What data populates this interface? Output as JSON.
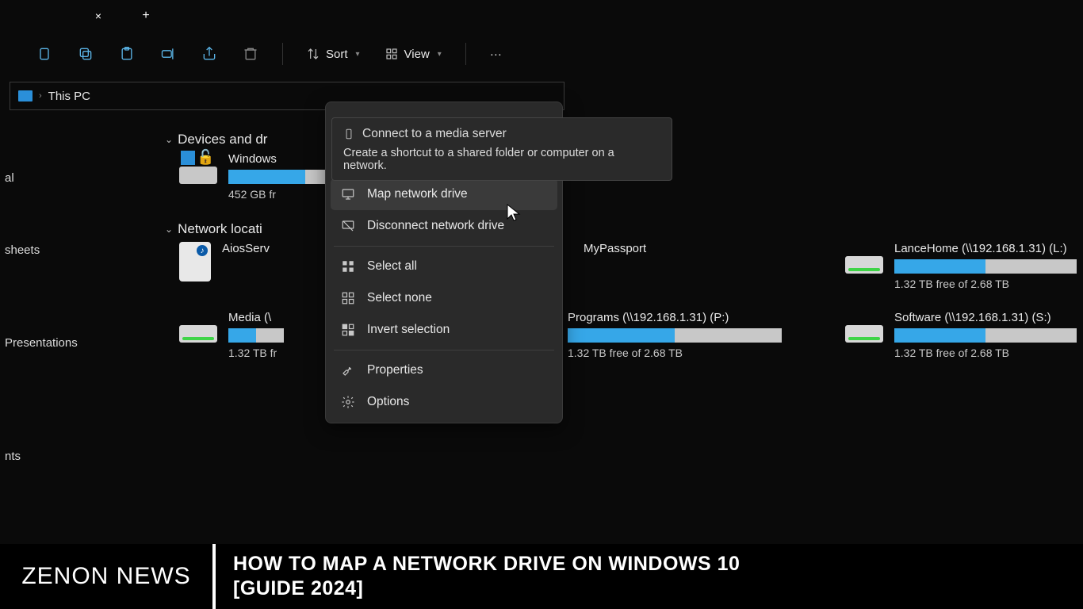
{
  "tabs": {
    "close": "×",
    "new": "+"
  },
  "toolbar": {
    "sort": "Sort",
    "view": "View"
  },
  "breadcrumb": {
    "sep": "›",
    "location": "This PC"
  },
  "sidebar": {
    "items": [
      "al",
      "sheets",
      "Presentations",
      "nts"
    ]
  },
  "sections": {
    "devices": "Devices and dr",
    "network": "Network locati"
  },
  "drives": {
    "local": {
      "name": "Windows",
      "free": "452 GB fr",
      "fill": 42
    },
    "aios": {
      "name": "AiosServ"
    },
    "mypassport": {
      "name": "MyPassport"
    },
    "lancehome": {
      "name": "LanceHome (\\\\192.168.1.31) (L:)",
      "free": "1.32 TB free of 2.68 TB",
      "fill": 50
    },
    "media": {
      "name": "Media (\\",
      "free": "1.32 TB fr",
      "fill": 50
    },
    "programs": {
      "name": "Programs (\\\\192.168.1.31) (P:)",
      "free": "1.32 TB free of 2.68 TB",
      "fill": 50
    },
    "software": {
      "name": "Software (\\\\192.168.1.31) (S:)",
      "free": "1.32 TB free of 2.68 TB",
      "fill": 50
    }
  },
  "tooltip": {
    "title": "Connect to a media server",
    "body": "Create a shortcut to a shared folder or computer on a network."
  },
  "menu": {
    "map": "Map network drive",
    "disconnect": "Disconnect network drive",
    "selectall": "Select all",
    "selectnone": "Select none",
    "invert": "Invert selection",
    "properties": "Properties",
    "options": "Options"
  },
  "footer": {
    "brand": "ZENON NEWS",
    "headline1": "HOW TO MAP A NETWORK DRIVE ON WINDOWS 10",
    "headline2": "[GUIDE 2024]"
  }
}
